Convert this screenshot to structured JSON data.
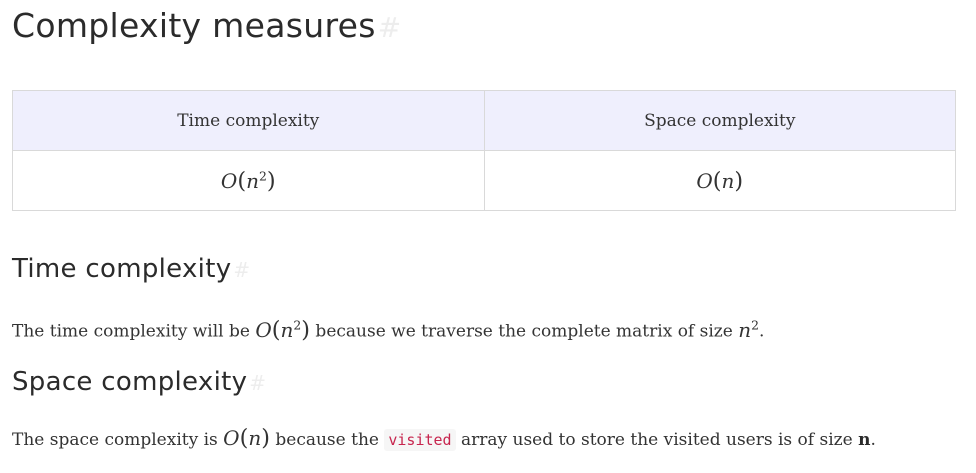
{
  "title": "Complexity measures",
  "anchor_symbol": "#",
  "table": {
    "headers": [
      "Time complexity",
      "Space complexity"
    ],
    "values": {
      "time": {
        "fn": "O",
        "arg": "n",
        "exp": "2"
      },
      "space": {
        "fn": "O",
        "arg": "n"
      }
    }
  },
  "time_section": {
    "heading": "Time complexity",
    "text_before": "The time complexity will be ",
    "math": {
      "fn": "O",
      "arg": "n",
      "exp": "2"
    },
    "text_after": " because we traverse the complete matrix of size ",
    "size_var": "n",
    "size_exp": "2",
    "end": "."
  },
  "space_section": {
    "heading": "Space complexity",
    "text_before": "The space complexity is ",
    "math": {
      "fn": "O",
      "arg": "n"
    },
    "text_middle": " because the ",
    "code": "visited",
    "text_after": " array used to store the visited users is of size ",
    "bold": "n",
    "end": "."
  }
}
